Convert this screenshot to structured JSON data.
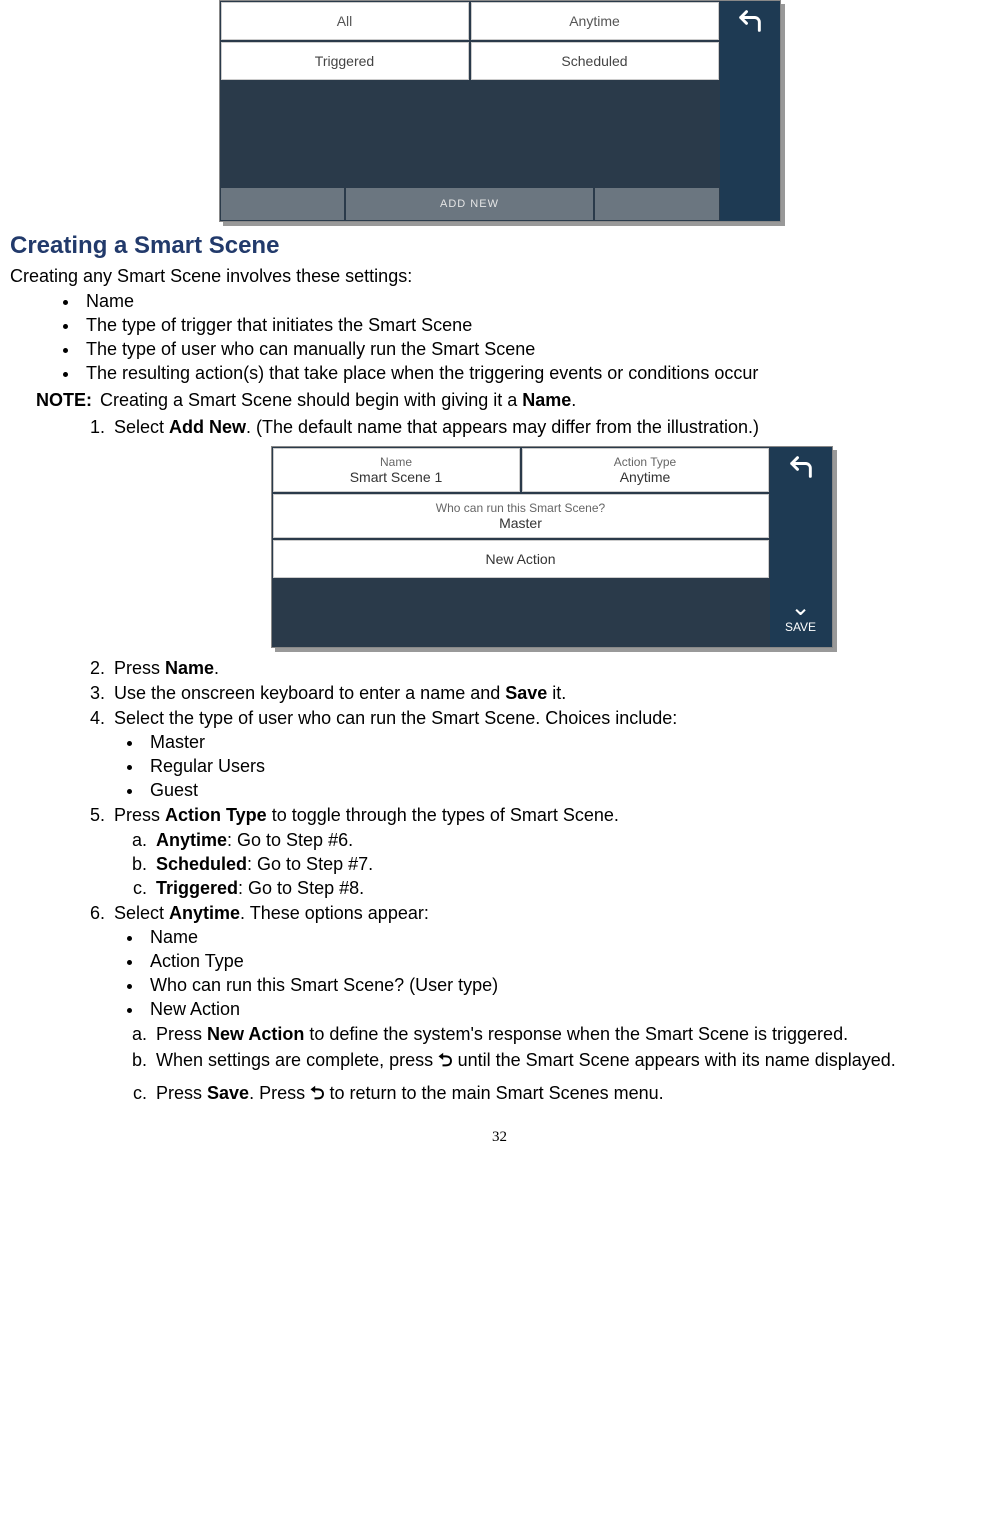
{
  "fig1": {
    "tabs": {
      "all": "All",
      "anytime": "Anytime",
      "triggered": "Triggered",
      "scheduled": "Scheduled"
    },
    "add_new": "ADD NEW",
    "back": "⮌"
  },
  "section": {
    "title": "Creating a Smart Scene"
  },
  "intro": "Creating any Smart Scene involves these settings:",
  "intro_bullets": {
    "b1": "Name",
    "b2": "The type of trigger that initiates the Smart Scene",
    "b3": "The type of user who can manually run the Smart Scene",
    "b4": "The resulting action(s) that take place when the triggering events or conditions occur"
  },
  "note": {
    "label": "NOTE",
    "colon": ":",
    "text_pre": "Creating a Smart Scene should begin with giving it a ",
    "text_bold": "Name",
    "text_post": "."
  },
  "step1": {
    "pre": "Select ",
    "bold": "Add New",
    "post": ". (The default name that appears may differ from the illustration.)"
  },
  "fig2": {
    "name_label": "Name",
    "name_value": "Smart Scene 1",
    "actiontype_label": "Action Type",
    "actiontype_value": "Anytime",
    "who_label": "Who can run this Smart Scene?",
    "who_value": "Master",
    "new_action": "New Action",
    "save": "SAVE",
    "back": "⮌",
    "chev": "⌄"
  },
  "step2": {
    "pre": "Press ",
    "bold": "Name",
    "post": "."
  },
  "step3": {
    "pre": "Use the onscreen keyboard to enter a name and ",
    "bold": "Save",
    "post": " it."
  },
  "step4": {
    "text": "Select the type of user who can run the Smart Scene. Choices include:",
    "opts": {
      "o1": "Master",
      "o2": "Regular Users",
      "o3": "Guest"
    }
  },
  "step5": {
    "pre": "Press ",
    "bold": "Action Type",
    "post": " to toggle through the types of Smart Scene.",
    "a": {
      "bold": "Anytime",
      "post": ": Go to Step #6."
    },
    "b": {
      "bold": "Scheduled",
      "post": ": Go to Step #7."
    },
    "c": {
      "bold": "Triggered",
      "post": ": Go to Step #8."
    }
  },
  "step6": {
    "pre": "Select ",
    "bold": "Anytime",
    "post": ". These options appear:",
    "opts": {
      "o1": "Name",
      "o2": "Action Type",
      "o3": "Who can run this Smart Scene? (User type)",
      "o4": "New Action"
    },
    "a": {
      "pre": "Press ",
      "bold": "New Action",
      "post": " to define the system's response when the Smart Scene is triggered."
    },
    "b": {
      "pre": "When settings are complete, press ",
      "icon": "⮌",
      "post": " until the Smart Scene appears with its name displayed."
    },
    "c": {
      "pre": "Press ",
      "bold": "Save",
      "mid": ". Press ",
      "icon": "⮌",
      "post": " to return to the main Smart Scenes menu."
    }
  },
  "pagenum": "32"
}
